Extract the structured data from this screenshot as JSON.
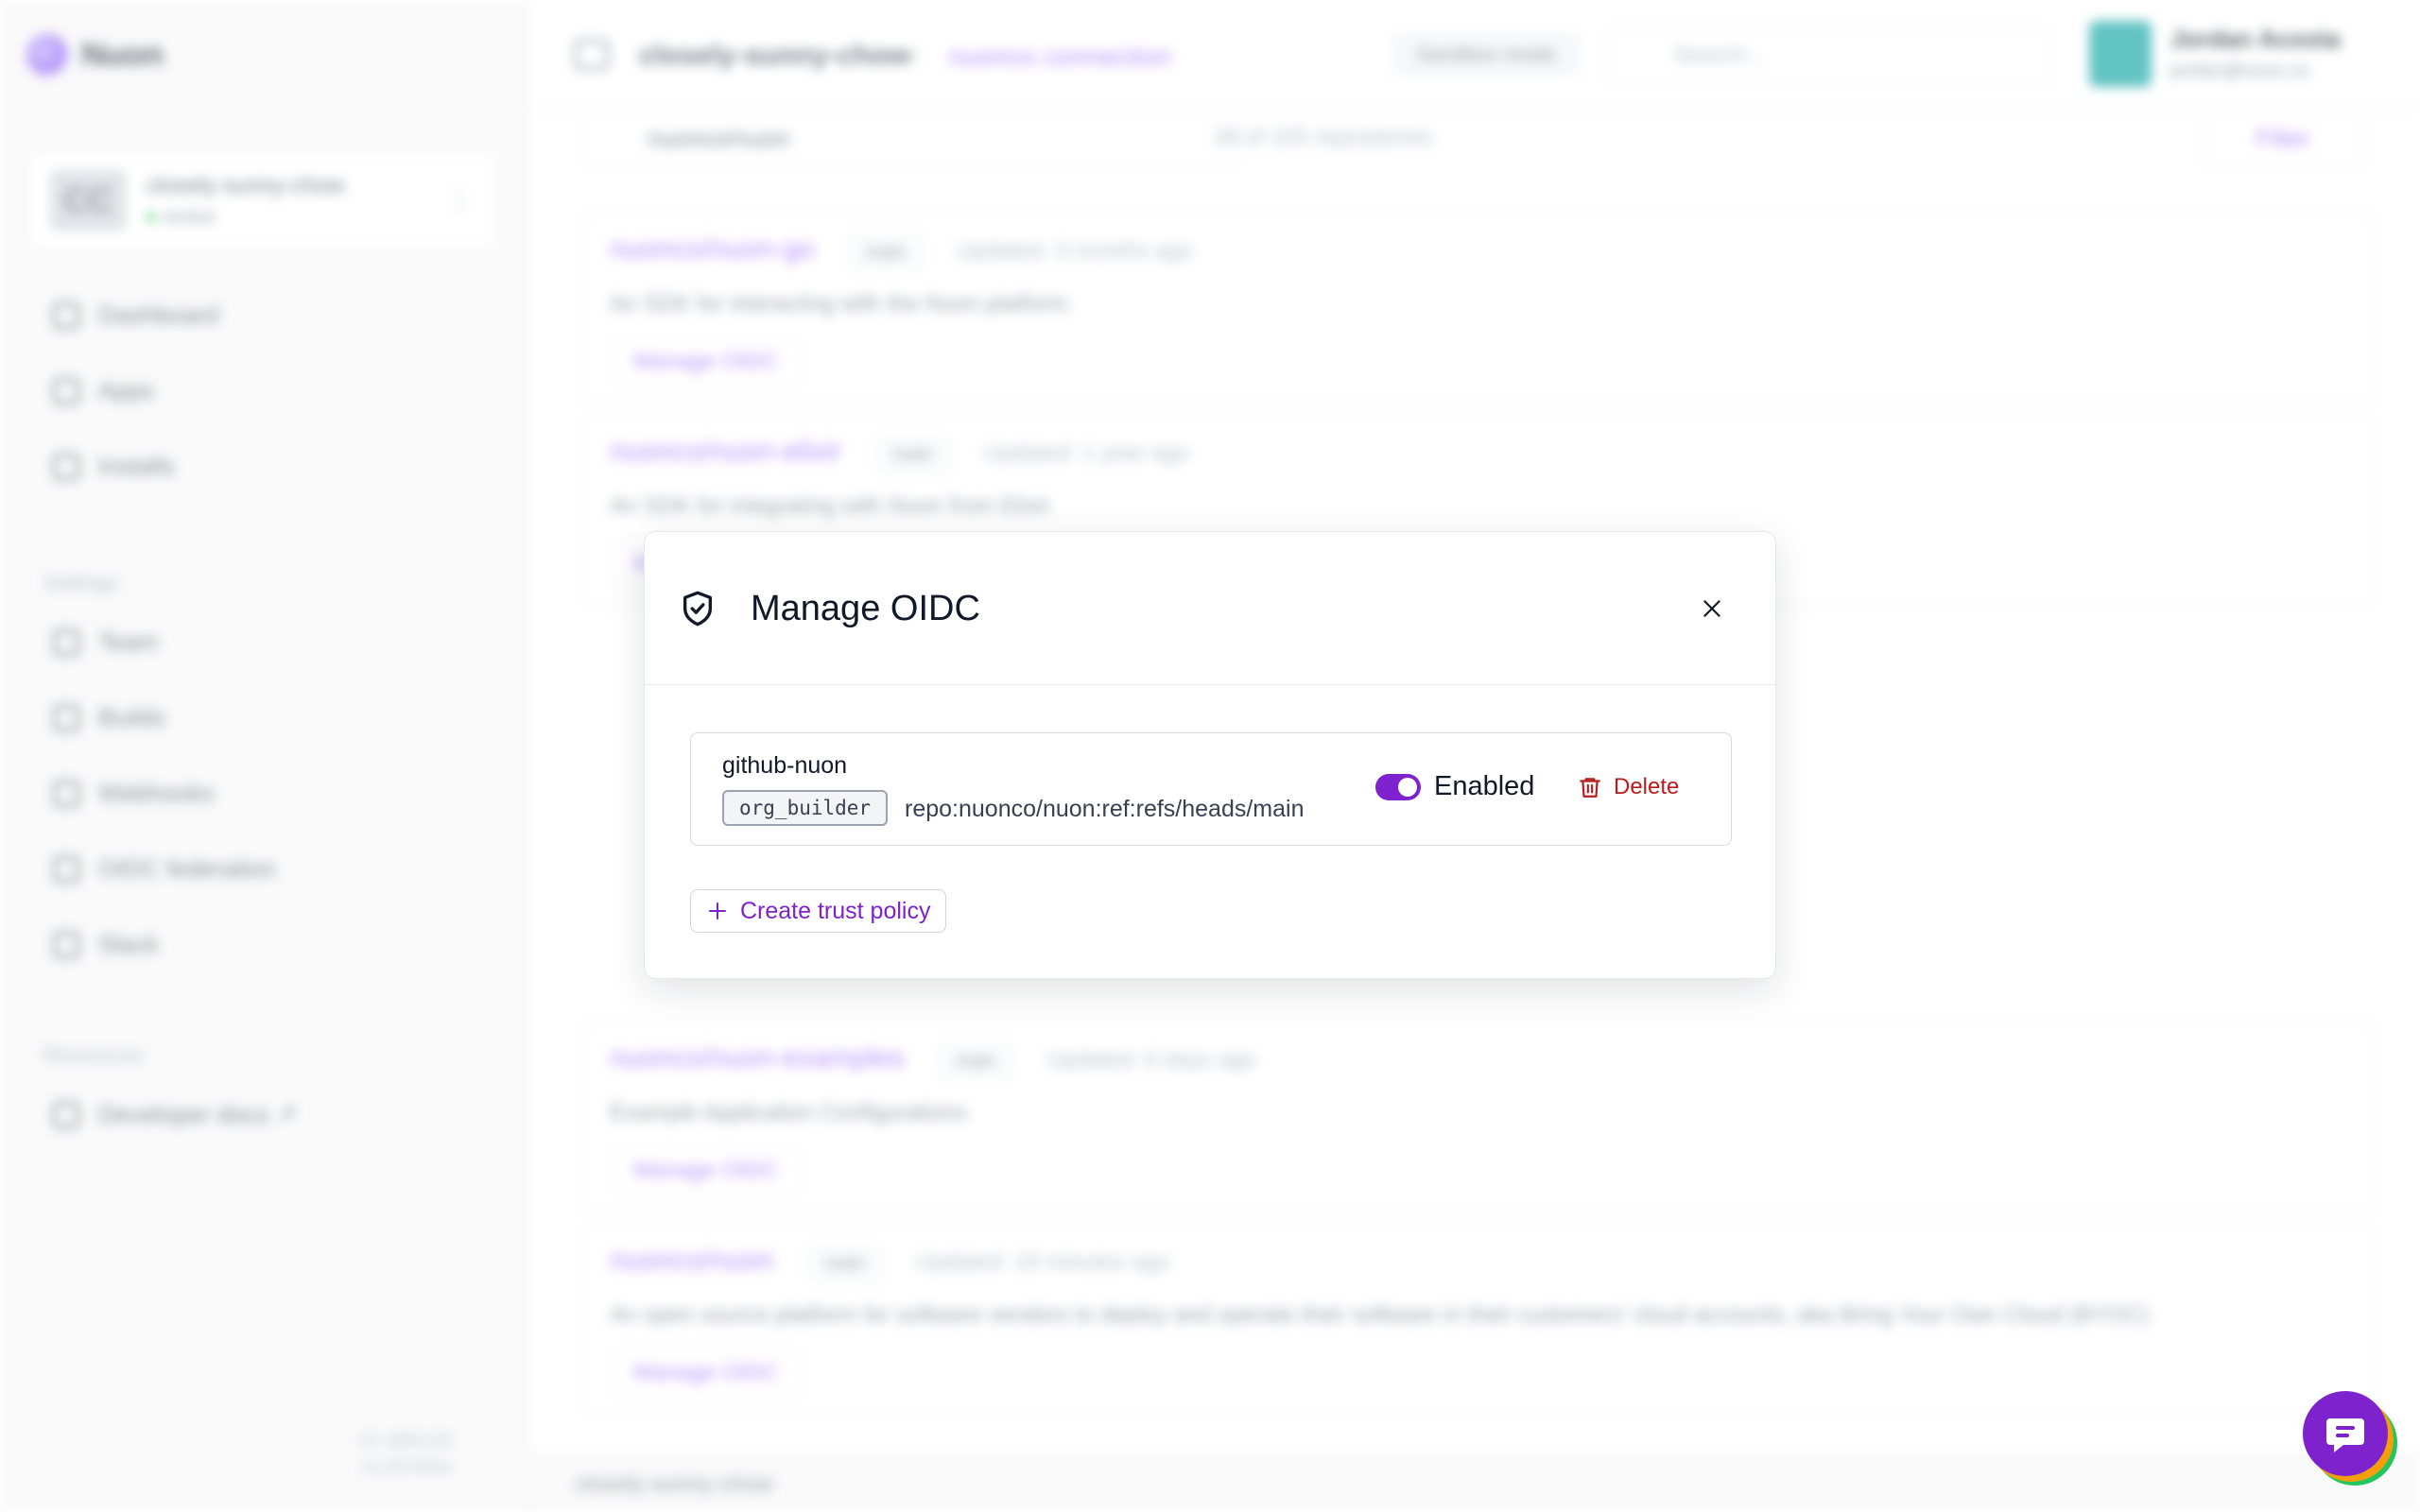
{
  "brand": {
    "logo_text": "Nuon"
  },
  "org": {
    "initials": "CC",
    "name": "closely-sunny-chow",
    "status": "Active"
  },
  "sidebar": {
    "nav": [
      {
        "label": "Dashboard"
      },
      {
        "label": "Apps"
      },
      {
        "label": "Installs"
      }
    ],
    "settings_heading": "Settings",
    "settings": [
      {
        "label": "Team"
      },
      {
        "label": "Builds"
      },
      {
        "label": "Webhooks"
      },
      {
        "label": "OIDC federation"
      },
      {
        "label": "Slack"
      }
    ],
    "resources_heading": "Resources",
    "resources": [
      {
        "label": "Developer docs ↗"
      }
    ],
    "version_line1": "UI: a0b1c2d",
    "version_line2": "v1.2074b3a"
  },
  "topbar": {
    "crumb_org": "closely-sunny-chow",
    "crumb_sep": "›",
    "crumb_page": "nuonco connection",
    "sandbox_badge": "Sandbox mode",
    "search_placeholder": "Search...",
    "user_name": "Jordan Acosta",
    "user_email": "jordan@nuon.co"
  },
  "main": {
    "repo_search_value": "nuonco/nuon",
    "repo_count": "38 of 105 repositories",
    "filter_label": "Filter",
    "repos": [
      {
        "name": "nuonco/nuon-go",
        "branch": "main",
        "updated": "Updated: 3 months ago",
        "desc": "An SDK for interacting with the Nuon platform.",
        "action": "Manage OIDC"
      },
      {
        "name": "nuonco/nuon-elixir",
        "branch": "main",
        "updated": "Updated: 1 year ago",
        "desc": "An SDK for integrating with Nuon from Elixir.",
        "action": "Manage OIDC"
      },
      {
        "name": "nuonco/nuon-examples",
        "branch": "main",
        "updated": "Updated: 6 days ago",
        "desc": "Example Application Configurations",
        "action": "Manage OIDC"
      },
      {
        "name": "nuonco/nuon",
        "branch": "main",
        "updated": "Updated: 16 minutes ago",
        "desc": "An open source platform for software vendors to deploy and operate their software in their customers' cloud accounts, aka Bring Your Own Cloud (BYOC)",
        "action": "Manage OIDC"
      }
    ]
  },
  "statusbar": {
    "text": "closely-sunny-chow"
  },
  "modal": {
    "title": "Manage OIDC",
    "policy": {
      "name": "github-nuon",
      "role": "org_builder",
      "subject": "repo:nuonco/nuon:ref:refs/heads/main",
      "enabled": true,
      "enabled_label": "Enabled",
      "delete_label": "Delete"
    },
    "create_label": "Create trust policy"
  },
  "colors": {
    "accent": "#7e22ce",
    "danger": "#b91c1c",
    "border": "#e5e7eb"
  }
}
